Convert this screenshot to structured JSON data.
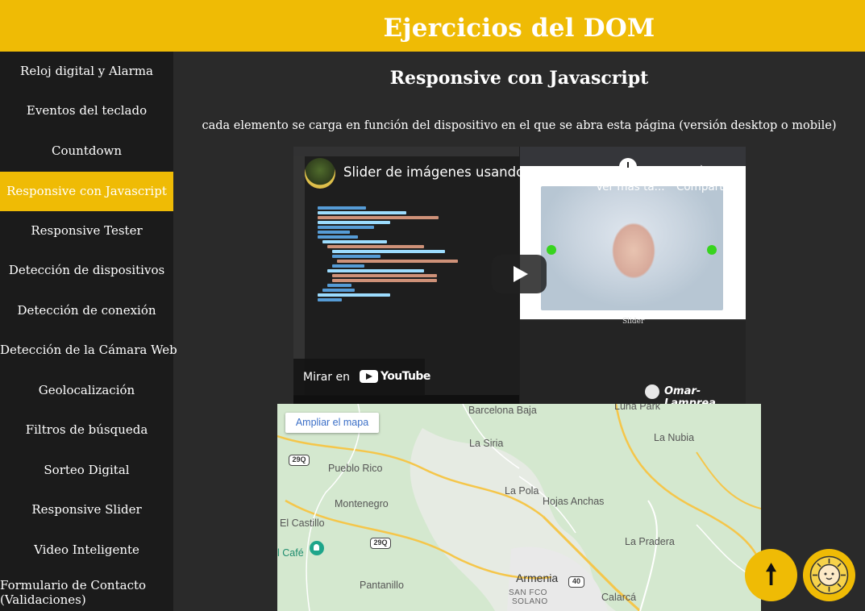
{
  "header": {
    "title": "Ejercicios del DOM"
  },
  "sidebar": {
    "items": [
      {
        "label": "Reloj digital y Alarma",
        "active": false
      },
      {
        "label": "Eventos del teclado",
        "active": false
      },
      {
        "label": "Countdown",
        "active": false
      },
      {
        "label": "Responsive con Javascript",
        "active": true
      },
      {
        "label": "Responsive Tester",
        "active": false
      },
      {
        "label": "Detección de dispositivos",
        "active": false
      },
      {
        "label": "Detección de conexión",
        "active": false
      },
      {
        "label": "Detección de la Cámara Web",
        "active": false
      },
      {
        "label": "Geolocalización",
        "active": false
      },
      {
        "label": "Filtros de búsqueda",
        "active": false
      },
      {
        "label": "Sorteo Digital",
        "active": false
      },
      {
        "label": "Responsive Slider",
        "active": false
      },
      {
        "label": "Video Inteligente",
        "active": false
      },
      {
        "label": "Formulario de Contacto (Validaciones)",
        "active": false
      }
    ]
  },
  "main": {
    "title": "Responsive con Javascript",
    "description": "cada elemento se carga en función del dispositivo en el que se abra esta página (versión desktop o mobile)"
  },
  "video": {
    "title": "Slider de imágenes usando Vanilla J...",
    "watch_later": "Ver más ta...",
    "share": "Compartir",
    "watch_on": "Mirar en",
    "youtube": "YouTube",
    "channel": "Omar-Lamprea",
    "slider_tag": "Slider"
  },
  "map": {
    "enlarge_button": "Ampliar el mapa",
    "labels": {
      "barcelona_baja": "Barcelona Baja",
      "luna_park": "Luna Park",
      "la_nubia": "La Nubia",
      "la_siria": "La Siria",
      "pueblo_rico": "Pueblo Rico",
      "la_pola": "La Pola",
      "hojas_anchas": "Hojas Anchas",
      "montenegro": "Montenegro",
      "el_castillo": "El Castillo",
      "cafe": "l Café",
      "la_pradera": "La Pradera",
      "pantanillo": "Pantanillo",
      "armenia": "Armenia",
      "san_fco": "SAN FCO",
      "solano": "SOLANO",
      "calarca": "Calarcá"
    },
    "shields": {
      "s1": "29Q",
      "s2": "29Q",
      "s3": "40"
    }
  },
  "floating": {
    "scroll_top_symbol": "🠕"
  },
  "colors": {
    "accent": "#efbb05",
    "sidebar_bg": "#1b1b1b",
    "main_bg": "#2a2a2a",
    "map_bg": "#d4e8cf"
  }
}
